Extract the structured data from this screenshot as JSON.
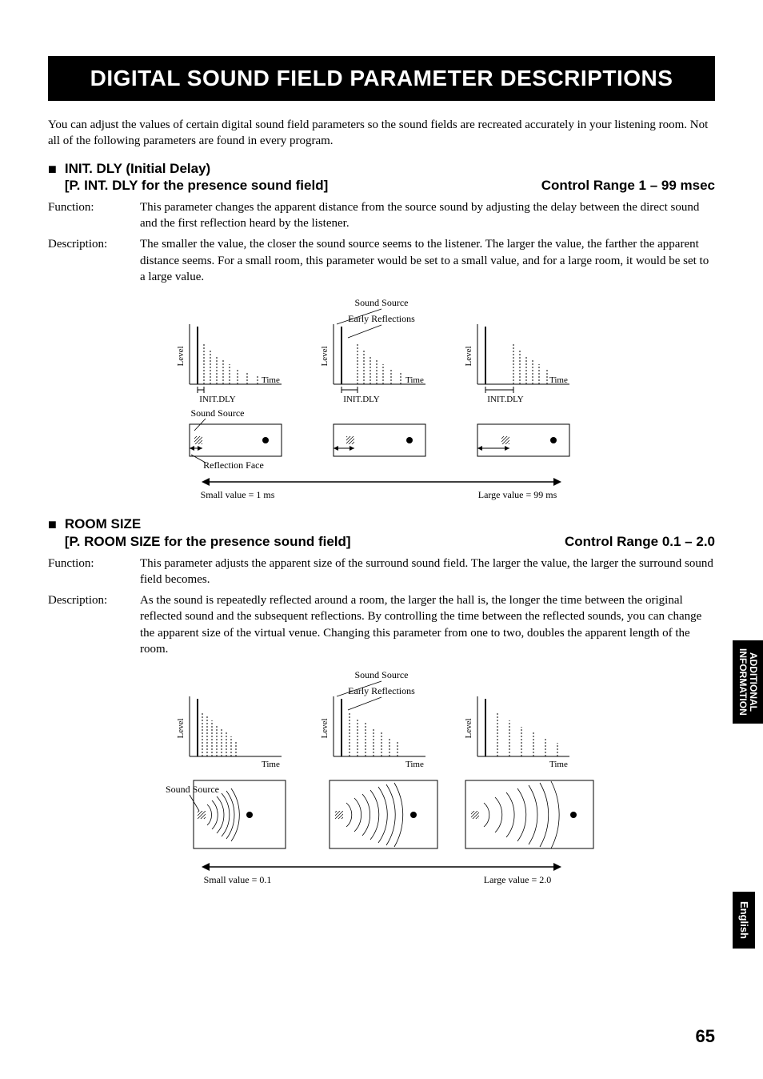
{
  "page_title": "DIGITAL SOUND FIELD PARAMETER DESCRIPTIONS",
  "intro": "You can adjust the values of certain digital sound field parameters so the sound fields are recreated accurately in your listening room. Not all of the following parameters are found in every program.",
  "section1": {
    "heading_line1": "INIT. DLY (Initial Delay)",
    "heading_line2_left": "[P. INT. DLY for the presence sound field]",
    "heading_line2_right": "Control Range 1 – 99 msec",
    "function_label": "Function:",
    "function_text": "This parameter changes the apparent distance from the source sound by adjusting the delay between the direct sound and the first reflection heard by the listener.",
    "description_label": "Description:",
    "description_text": "The smaller the value, the closer the sound source seems to the listener. The larger the value, the farther the apparent distance seems. For a small room, this parameter would be set to a small value, and for a large room, it would be set to a large value.",
    "fig": {
      "sound_source": "Sound Source",
      "early_reflections": "Early Reflections",
      "level": "Level",
      "time": "Time",
      "init_dly": "INIT.DLY",
      "reflection_face": "Reflection Face",
      "small_value": "Small value = 1 ms",
      "large_value": "Large value = 99 ms"
    }
  },
  "section2": {
    "heading_line1": "ROOM SIZE",
    "heading_line2_left": "[P. ROOM SIZE for the presence sound field]",
    "heading_line2_right": "Control Range 0.1 – 2.0",
    "function_label": "Function:",
    "function_text": "This parameter adjusts the apparent size of the surround sound field. The larger the value, the larger the surround sound field becomes.",
    "description_label": "Description:",
    "description_text": "As the sound is repeatedly reflected around a room, the larger the hall is, the longer the time between the original reflected sound and the subsequent reflections. By controlling the time between the reflected sounds, you can change the apparent size of the virtual venue. Changing this parameter from one to two, doubles the apparent length of the room.",
    "fig": {
      "sound_source": "Sound Source",
      "early_reflections": "Early Reflections",
      "level": "Level",
      "time": "Time",
      "small_value": "Small value = 0.1",
      "large_value": "Large value = 2.0"
    }
  },
  "side_tab1_line1": "ADDITIONAL",
  "side_tab1_line2": "INFORMATION",
  "side_tab2": "English",
  "page_number": "65"
}
